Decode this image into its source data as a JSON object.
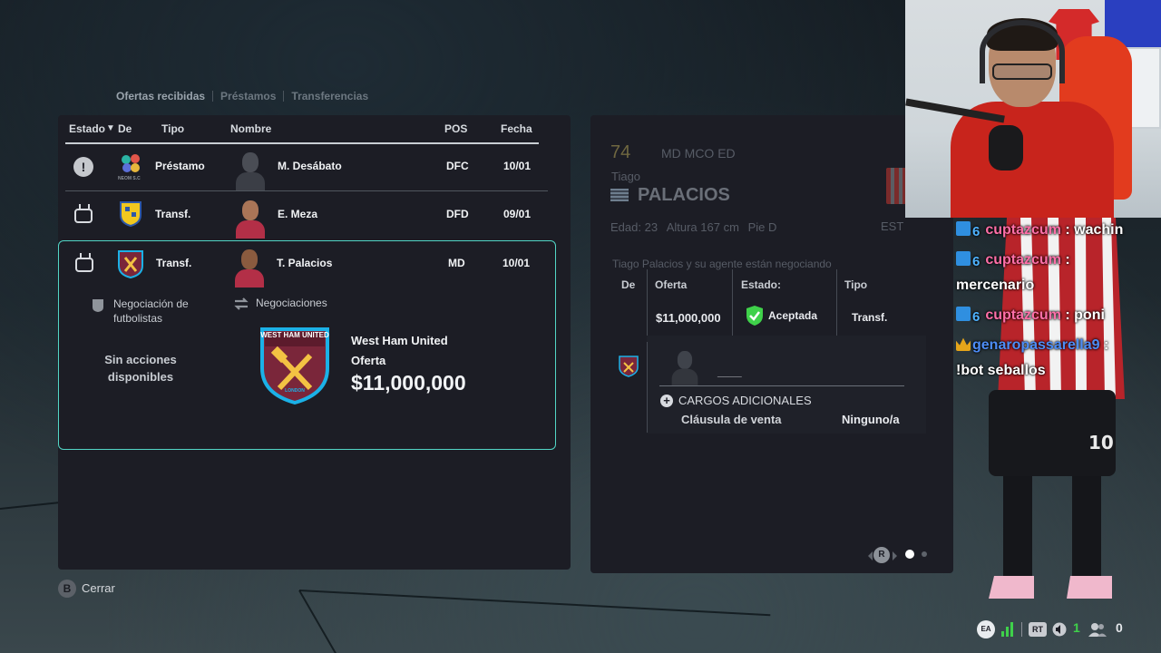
{
  "tabs": [
    {
      "label": "Ofertas recibidas",
      "active": true
    },
    {
      "label": "Préstamos",
      "active": false
    },
    {
      "label": "Transferencias",
      "active": false
    }
  ],
  "table": {
    "headers": {
      "status": "Estado",
      "sort_arrow": "▼",
      "from": "De",
      "type": "Tipo",
      "name": "Nombre",
      "pos": "POS",
      "date": "Fecha"
    },
    "rows": [
      {
        "status_icon": "alert-icon",
        "club_icon": "neom-sc-crest-icon",
        "type": "Préstamo",
        "name": "M. Desábato",
        "pos": "DFC",
        "date": "10/01"
      },
      {
        "status_icon": "tv-icon",
        "club_icon": "club-crest-icon",
        "type": "Transf.",
        "name": "E. Meza",
        "pos": "DFD",
        "date": "09/01"
      },
      {
        "status_icon": "tv-icon",
        "club_icon": "west-ham-crest-icon",
        "type": "Transf.",
        "name": "T. Palacios",
        "pos": "MD",
        "date": "10/01"
      }
    ],
    "small_club_label": "NEOM S.C"
  },
  "selected": {
    "action1": "Negociación de futbolistas",
    "action2": "Negociaciones",
    "no_actions": "Sin acciones disponibles",
    "club": "West Ham United",
    "offer_label": "Oferta",
    "offer_amount": "$11,000,000",
    "crest_top": "WEST HAM UNITED",
    "crest_bottom": "LONDON"
  },
  "player_card": {
    "rating": "74",
    "positions": "MD  MCO  ED",
    "first_name": "Tiago",
    "last_name": "PALACIOS",
    "age_label": "Edad:",
    "age": "23",
    "height_label": "Altura",
    "height": "167 cm",
    "foot_label": "Pie",
    "foot": "D",
    "club_short": "EST",
    "negotiation_note": "Tiago Palacios y su agente están negociando",
    "offer_headers": {
      "from": "De",
      "offer": "Oferta",
      "status": "Estado:",
      "type": "Tipo"
    },
    "offer_values": {
      "offer": "$11,000,000",
      "status": "Aceptada",
      "type": "Transf."
    },
    "blank_name": "____",
    "extras_title": "CARGOS ADICIONALES",
    "sell_clause_label": "Cláusula de venta",
    "sell_clause_value": "Ninguno/a"
  },
  "pager": {
    "stick_label": "R"
  },
  "chat": [
    {
      "user": "cuptazcum",
      "sep": " : ",
      "msg": "wachin",
      "badge": "sub",
      "color": "#ff6fa8"
    },
    {
      "user": "cuptazcum",
      "sep": " :",
      "msg": "mercenario",
      "badge": "sub",
      "color": "#ff6fa8"
    },
    {
      "user": "cuptazcum",
      "sep": " : ",
      "msg": "poni",
      "badge": "sub",
      "color": "#ff6fa8"
    },
    {
      "user": "genaropassarella9",
      "sep": " :",
      "msg": "!bot seballos",
      "badge": "crown",
      "color": "#4d8df7"
    }
  ],
  "footer": {
    "button": "B",
    "close": "Cerrar"
  },
  "hud": {
    "ea_label": "EA",
    "rt_label": "RT",
    "count1": "1",
    "count2": "0"
  },
  "colors": {
    "accent": "#52d6c6",
    "panel": "#1c1d25",
    "accepted": "#3fd14a",
    "west_ham_claret": "#7a263a",
    "west_ham_blue": "#1bb1e7"
  }
}
